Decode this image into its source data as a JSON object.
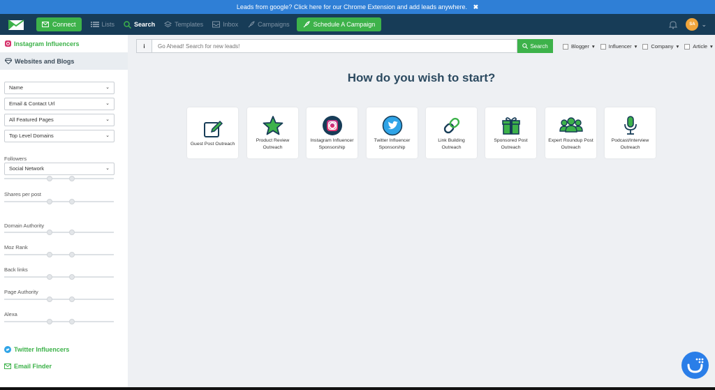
{
  "banner": {
    "text": "Leads from google? Click here for our Chrome Extension and add leads anywhere.",
    "close": "✖"
  },
  "nav": {
    "connect": "Connect",
    "items": [
      {
        "label": "Lists",
        "icon": "list-icon"
      },
      {
        "label": "Search",
        "icon": "search-icon"
      },
      {
        "label": "Templates",
        "icon": "templates-icon"
      },
      {
        "label": "Inbox",
        "icon": "inbox-icon"
      },
      {
        "label": "Campaigns",
        "icon": "campaigns-icon"
      }
    ],
    "schedule": "Schedule A Campaign",
    "avatar": "SA",
    "avatar_caret": "⌄"
  },
  "sidebar": {
    "instagram": "Instagram Influencers",
    "websites": "Websites and Blogs",
    "selects": [
      "Name",
      "Email & Contact Url",
      "All Featured Pages",
      "Top Level Domains"
    ],
    "followers_label": "Followers",
    "followers_select": "Social Network",
    "filters": [
      "Shares per post",
      "Domain Authority",
      "Moz Rank",
      "Back links",
      "Page Authority",
      "Alexa"
    ],
    "twitter": "Twitter Influencers",
    "email_finder": "Email Finder"
  },
  "search": {
    "info": "i",
    "placeholder": "Go Ahead! Search for new leads!",
    "button": "Search",
    "filters": [
      "Blogger",
      "Influencer",
      "Company",
      "Article"
    ]
  },
  "heading": "How do you wish to start?",
  "cards": [
    {
      "label": "Guest Post Outreach",
      "icon": "edit-icon"
    },
    {
      "label": "Product Review Outreach",
      "icon": "star-icon"
    },
    {
      "label": "Instagram Influencer Sponsorship",
      "icon": "instagram-icon"
    },
    {
      "label": "Twitter Influencer Sponsorship",
      "icon": "twitter-icon"
    },
    {
      "label": "Link Building Outreach",
      "icon": "link-icon"
    },
    {
      "label": "Sponsored Post Outreach",
      "icon": "gift-icon"
    },
    {
      "label": "Expert Roundup Post Outreach",
      "icon": "users-icon"
    },
    {
      "label": "Podcast/Interview Outreach",
      "icon": "microphone-icon"
    }
  ],
  "colors": {
    "green": "#3db24a",
    "navy": "#173c57",
    "banner": "#2f7fd6",
    "heading": "#2c4a60"
  }
}
